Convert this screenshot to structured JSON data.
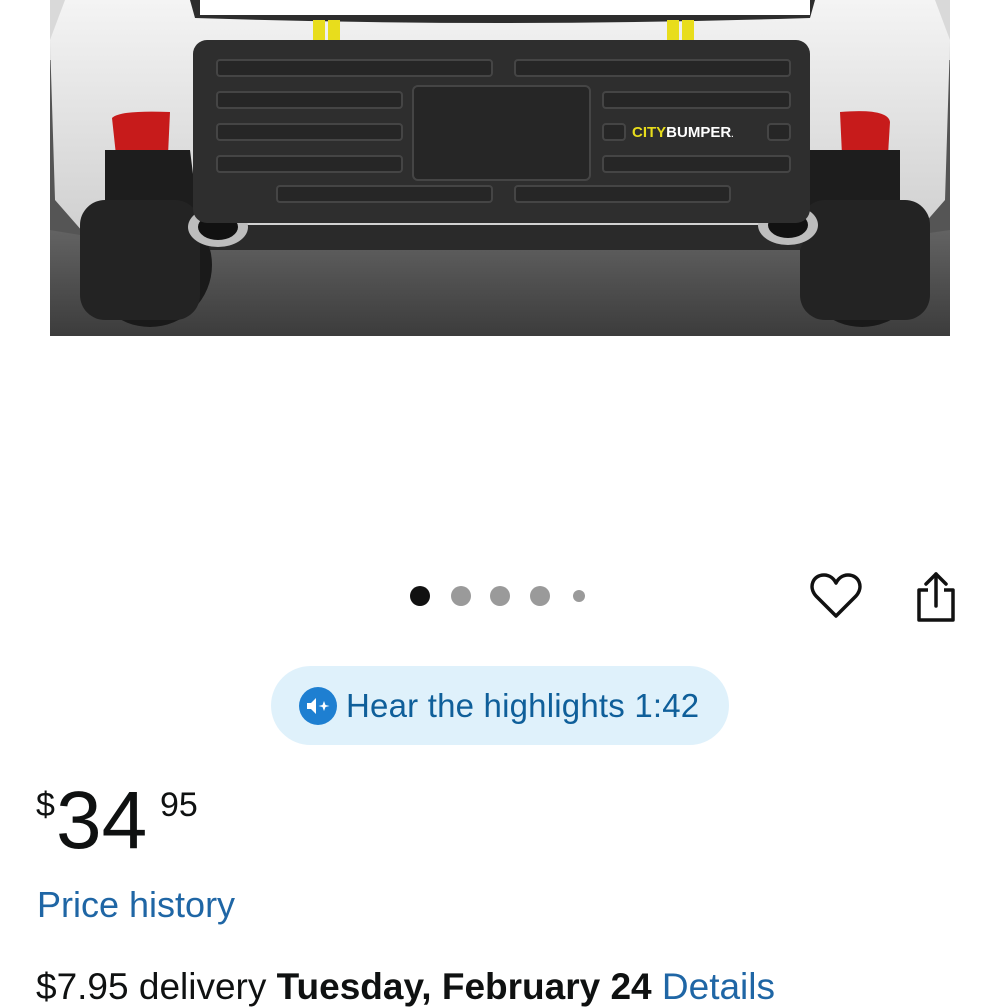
{
  "product_image": {
    "alt": "Rear bumper protector mounted on white car",
    "brand_mark_primary": "CITY",
    "brand_mark_secondary": "BUMPER",
    "brand_mark_suffix": "."
  },
  "carousel": {
    "total_dots": 5,
    "active_index": 0
  },
  "actions": {
    "favorite_icon": "heart-icon",
    "share_icon": "share-icon"
  },
  "highlights": {
    "label": "Hear the highlights 1:42",
    "icon": "audio-sparkle-icon"
  },
  "price": {
    "symbol": "$",
    "whole": "34",
    "fraction": "95"
  },
  "price_history": {
    "label": "Price history"
  },
  "delivery": {
    "fee": "$7.95 delivery",
    "date": "Tuesday, February 24",
    "details": "Details"
  },
  "colors": {
    "link": "#1f66a5",
    "pill_bg": "#dff1fb",
    "pill_icon": "#1e7fd1",
    "brand_yellow": "#e8dd1c"
  }
}
